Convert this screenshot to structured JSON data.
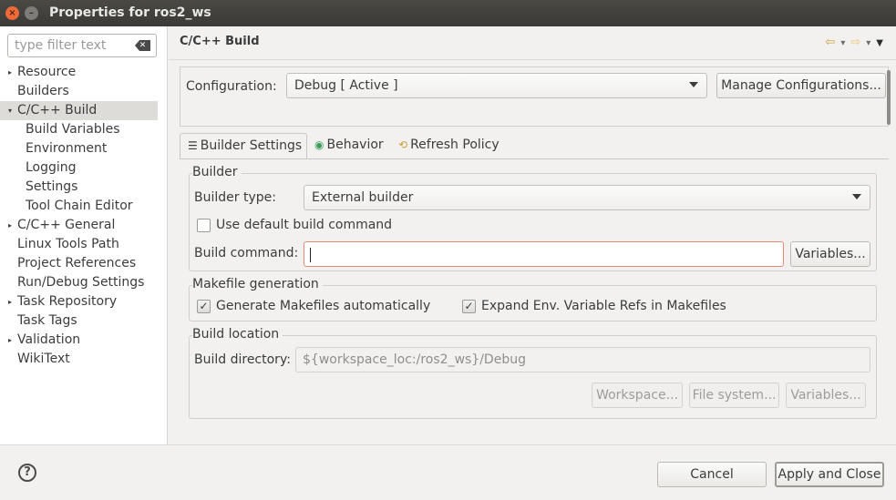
{
  "window": {
    "title": "Properties for ros2_ws",
    "close_glyph": "×",
    "minimize_glyph": "–"
  },
  "sidebar": {
    "filter_placeholder": "type filter text",
    "items": [
      {
        "label": "Resource",
        "expander": "▸"
      },
      {
        "label": "Builders",
        "expander": ""
      },
      {
        "label": "C/C++ Build",
        "expander": "▾"
      },
      {
        "label": "Build Variables",
        "expander": ""
      },
      {
        "label": "Environment",
        "expander": ""
      },
      {
        "label": "Logging",
        "expander": ""
      },
      {
        "label": "Settings",
        "expander": ""
      },
      {
        "label": "Tool Chain Editor",
        "expander": ""
      },
      {
        "label": "C/C++ General",
        "expander": "▸"
      },
      {
        "label": "Linux Tools Path",
        "expander": ""
      },
      {
        "label": "Project References",
        "expander": ""
      },
      {
        "label": "Run/Debug Settings",
        "expander": ""
      },
      {
        "label": "Task Repository",
        "expander": "▸"
      },
      {
        "label": "Task Tags",
        "expander": ""
      },
      {
        "label": "Validation",
        "expander": "▸"
      },
      {
        "label": "WikiText",
        "expander": ""
      }
    ]
  },
  "page": {
    "title": "C/C++ Build",
    "nav_icons": {
      "back": "⇦",
      "forward": "⇨",
      "dropdown": "▾",
      "menu": "▼"
    }
  },
  "configuration": {
    "label": "Configuration:",
    "value": "Debug  [ Active ]",
    "manage_button": "Manage Configurations..."
  },
  "tabs": [
    {
      "label": "Builder Settings",
      "icon": "☰"
    },
    {
      "label": "Behavior",
      "icon": "◉"
    },
    {
      "label": "Refresh Policy",
      "icon": "⟲"
    }
  ],
  "builder": {
    "group_title": "Builder",
    "type_label": "Builder type:",
    "type_value": "External builder",
    "use_default_label": "Use default build command",
    "command_label": "Build command:",
    "command_value": "",
    "variables_button": "Variables..."
  },
  "makefile": {
    "group_title": "Makefile generation",
    "generate_label": "Generate Makefiles automatically",
    "expand_label": "Expand Env. Variable Refs in Makefiles",
    "check_glyph": "✓"
  },
  "location": {
    "group_title": "Build location",
    "dir_label": "Build directory:",
    "dir_value": "${workspace_loc:/ros2_ws}/Debug",
    "workspace_button": "Workspace...",
    "filesystem_button": "File system...",
    "variables_button": "Variables..."
  },
  "footer": {
    "help_glyph": "?",
    "cancel": "Cancel",
    "apply_close": "Apply and Close"
  }
}
